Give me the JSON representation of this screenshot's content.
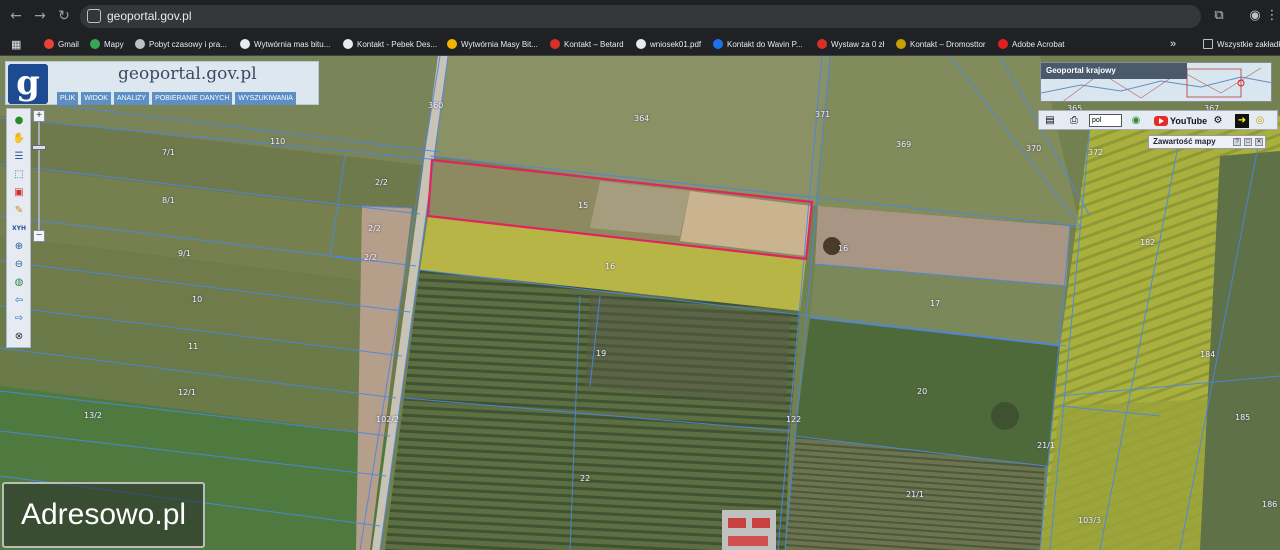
{
  "browser": {
    "url": "geoportal.gov.pl",
    "all_bookmarks": "Wszystkie zakładki",
    "bookmarks": [
      {
        "label": "Gmail",
        "color": "#ea4335"
      },
      {
        "label": "Mapy",
        "color": "#34a853"
      },
      {
        "label": "Pobyt czasowy i pra...",
        "color": "#bdc1c6"
      },
      {
        "label": "Wytwórnia mas bitu...",
        "color": "#e8eaed"
      },
      {
        "label": "Kontakt - Pebek Des...",
        "color": "#e8eaed"
      },
      {
        "label": "Wytwórnia Masy Bit...",
        "color": "#f4b400"
      },
      {
        "label": "Kontakt – Betard",
        "color": "#d93025"
      },
      {
        "label": "wniosek01.pdf",
        "color": "#e8eaed"
      },
      {
        "label": "Kontakt do Wavin P...",
        "color": "#1a73e8"
      },
      {
        "label": "Wystaw za 0 zł",
        "color": "#d93025"
      },
      {
        "label": "Kontakt – Dromosttor",
        "color": "#c8a000"
      },
      {
        "label": "Adobe Acrobat",
        "color": "#e02020"
      }
    ]
  },
  "geoportal": {
    "logo_letter": "g",
    "logo_text": "geoportal.gov.pl",
    "menu": [
      "PLIK",
      "WIDOK",
      "ANALIZY",
      "POBIERANIE DANYCH",
      "WYSZUKIWANIA"
    ],
    "overview_title": "Geoportal krajowy",
    "language": "pol",
    "youtube_label": "YouTube",
    "contents_title": "Zawartość mapy",
    "contents_buttons": [
      "?",
      "□",
      "✕"
    ]
  },
  "toolbar": {
    "icons": [
      "info-icon",
      "hand-pan-icon",
      "list-icon",
      "select-area-icon",
      "select-red-icon",
      "draw-pencil-icon",
      "xyh-coordinates-icon",
      "zoom-in-icon",
      "zoom-out-icon",
      "globe-icon",
      "arrow-back-icon",
      "arrow-forward-icon",
      "crosshair-icon"
    ],
    "xyh_label": "XYH"
  },
  "parcels": [
    {
      "label": "7/1"
    },
    {
      "label": "8/1"
    },
    {
      "label": "9/1"
    },
    {
      "label": "10"
    },
    {
      "label": "11"
    },
    {
      "label": "12/1"
    },
    {
      "label": "13/2"
    },
    {
      "label": "110"
    },
    {
      "label": "2/2"
    },
    {
      "label": "2/2"
    },
    {
      "label": "2/2"
    },
    {
      "label": "360"
    },
    {
      "label": "364"
    },
    {
      "label": "371"
    },
    {
      "label": "369"
    },
    {
      "label": "370"
    },
    {
      "label": "372"
    },
    {
      "label": "15"
    },
    {
      "label": "16"
    },
    {
      "label": "16"
    },
    {
      "label": "17"
    },
    {
      "label": "19"
    },
    {
      "label": "20"
    },
    {
      "label": "22"
    },
    {
      "label": "21/1"
    },
    {
      "label": "21/1"
    },
    {
      "label": "102/2"
    },
    {
      "label": "122"
    },
    {
      "label": "182"
    },
    {
      "label": "184"
    },
    {
      "label": "185"
    },
    {
      "label": "103/3"
    },
    {
      "label": "186"
    },
    {
      "label": "365"
    },
    {
      "label": "367"
    }
  ],
  "colors": {
    "highlight": "#e0245e",
    "boundary": "#4a86e8",
    "menu_bg": "#5e8fc4"
  },
  "watermark": "Adresowo.pl"
}
